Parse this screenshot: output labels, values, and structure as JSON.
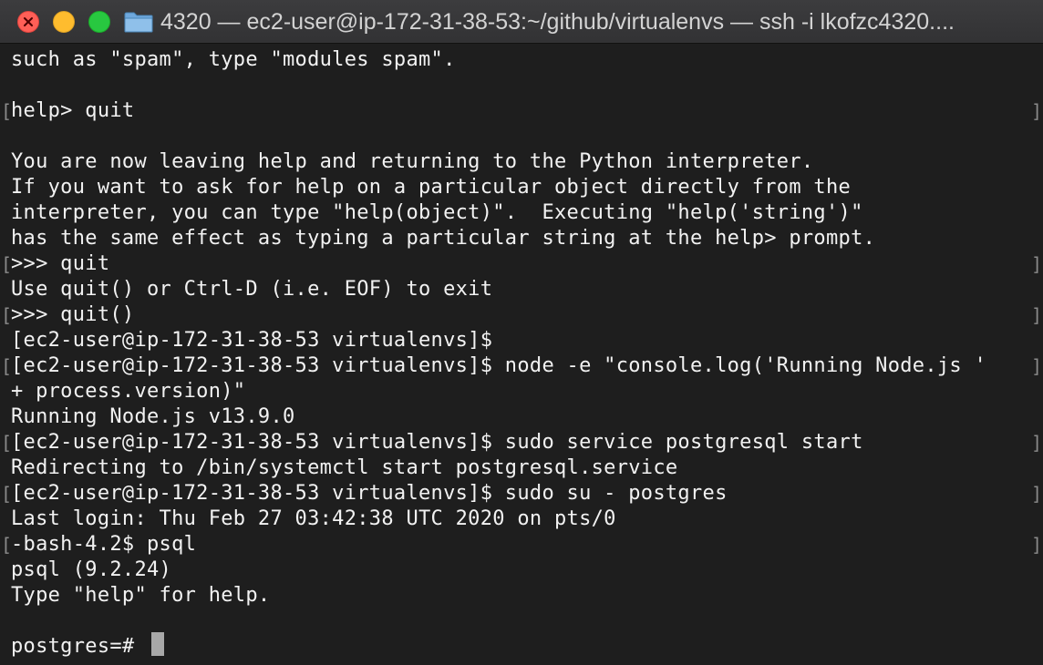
{
  "window": {
    "title": "4320 — ec2-user@ip-172-31-38-53:~/github/virtualenvs — ssh -i lkofzc4320....",
    "folder_icon": "folder-icon",
    "close_icon": "close-icon",
    "minimize_icon": "minimize-icon",
    "zoom_icon": "zoom-icon",
    "colors": {
      "close": "#ff5f57",
      "minimize": "#febc2e",
      "zoom": "#28c840",
      "background": "#1e1e1e",
      "text": "#f2f2f2"
    }
  },
  "terminal": {
    "lines": [
      "such as \"spam\", type \"modules spam\".",
      "",
      "help> quit",
      "",
      "You are now leaving help and returning to the Python interpreter.",
      "If you want to ask for help on a particular object directly from the",
      "interpreter, you can type \"help(object)\".  Executing \"help('string')\"",
      "has the same effect as typing a particular string at the help> prompt.",
      ">>> quit",
      "Use quit() or Ctrl-D (i.e. EOF) to exit",
      ">>> quit()",
      "[ec2-user@ip-172-31-38-53 virtualenvs]$",
      "[ec2-user@ip-172-31-38-53 virtualenvs]$ node -e \"console.log('Running Node.js '",
      "+ process.version)\"",
      "Running Node.js v13.9.0",
      "[ec2-user@ip-172-31-38-53 virtualenvs]$ sudo service postgresql start",
      "Redirecting to /bin/systemctl start postgresql.service",
      "[ec2-user@ip-172-31-38-53 virtualenvs]$ sudo su - postgres",
      "Last login: Thu Feb 27 03:42:38 UTC 2020 on pts/0",
      "-bash-4.2$ psql",
      "psql (9.2.24)",
      "Type \"help\" for help.",
      "",
      "postgres=# "
    ],
    "mark_left": "[",
    "mark_right": "]"
  }
}
